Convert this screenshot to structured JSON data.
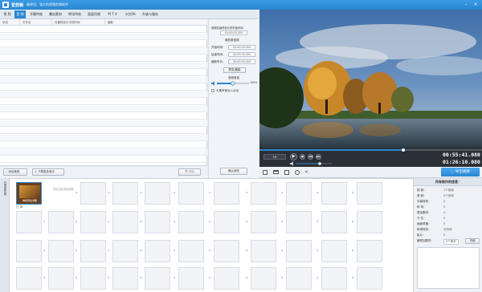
{
  "window": {
    "title": "爱剪辑",
    "slogan": "最易用、强大的视频剪辑软件",
    "controls": {
      "minimize": "–",
      "close": "×"
    }
  },
  "menu": {
    "tabs": [
      {
        "label": "视 频",
        "active": false
      },
      {
        "label": "音 频",
        "active": true
      },
      {
        "label": "字幕特效",
        "active": false
      },
      {
        "label": "叠加素材",
        "active": false
      },
      {
        "label": "转场特效",
        "active": false
      },
      {
        "label": "画面风格",
        "active": false
      },
      {
        "label": "M T V",
        "active": false
      },
      {
        "label": "卡拉OK",
        "active": false
      },
      {
        "label": "升级与服务",
        "active": false
      }
    ]
  },
  "audio_list": {
    "columns": [
      "状态",
      "文件名",
      "在最终影片中的时间",
      "截取"
    ]
  },
  "settings": {
    "heading": "音频在最终影片的开始时间",
    "start_time": "00:00:00.000",
    "clip_heading": "裁剪原音频",
    "start_label": "开始时间：",
    "start_value": "00:00:00.000",
    "end_label": "结束时间：",
    "end_value": "00:00:00.000",
    "dur_label": "截取时长：",
    "dur_value": "00:00:00.000",
    "preview_button": "预览/截取",
    "volume_heading": "音频音量",
    "volume_value": "100%",
    "fade_label": "头尾声音淡入淡出",
    "confirm_button": "确认修改"
  },
  "list_bar": {
    "add_audio": "添加音频",
    "download_music": "下载更多音乐",
    "delete": "删除"
  },
  "player": {
    "current_time": "00:55:41.080",
    "total_time": "01:26:10.080",
    "speed_label": "1X"
  },
  "toolbar": {
    "export_button": "导出视频"
  },
  "timeline": {
    "side_label": "已添加片段",
    "clip_caption": "神秘黄金满眼",
    "clip_sub": "已 添",
    "hint": "双击此处添加视频"
  },
  "info": {
    "title": "所有制作的信息：",
    "rows": [
      {
        "key": "视 频：",
        "value": "1个视频"
      },
      {
        "key": "音 频：",
        "value": "0个音频"
      },
      {
        "key": "字幕特效：",
        "value": "0"
      },
      {
        "key": "转 场：",
        "value": "0"
      },
      {
        "key": "叠加素材：",
        "value": "0"
      },
      {
        "key": "卡 拉：",
        "value": "0"
      },
      {
        "key": "画面风格：",
        "value": "0"
      },
      {
        "key": "转场特效：",
        "value": "无特效"
      },
      {
        "key": "影片：",
        "value": "0"
      },
      {
        "key": "最短加载时：",
        "value": "0个素材"
      }
    ],
    "open_button": "详细"
  },
  "colors": {
    "accent": "#2a86d2",
    "titlebar": "#3a9be4",
    "player_bg": "#2b2f36"
  }
}
